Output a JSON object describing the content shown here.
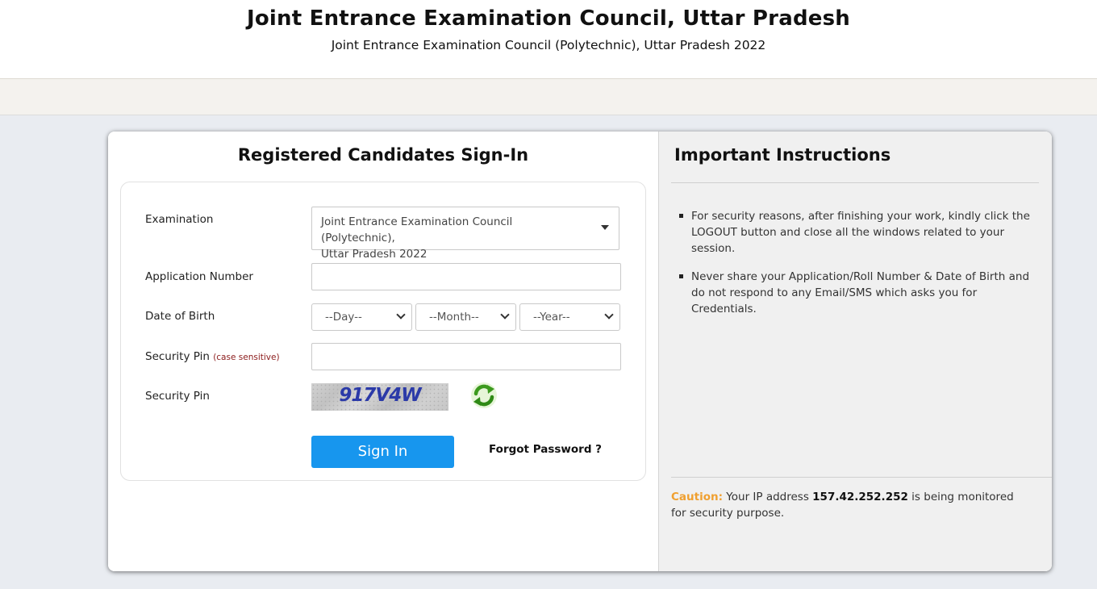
{
  "header": {
    "title": "Joint Entrance Examination Council, Uttar Pradesh",
    "subtitle": "Joint Entrance Examination Council (Polytechnic), Uttar Pradesh 2022"
  },
  "signin": {
    "title": "Registered Candidates Sign-In",
    "examination_label": "Examination",
    "examination_value_line1": "Joint Entrance Examination Council (Polytechnic),",
    "examination_value_line2": "Uttar Pradesh 2022",
    "application_label": "Application Number",
    "application_value": "",
    "dob_label": "Date of Birth",
    "dob_day": "--Day--",
    "dob_month": "--Month--",
    "dob_year": "--Year--",
    "security_pin_label": "Security Pin",
    "security_pin_hint": "(case sensitive)",
    "security_pin_value": "",
    "captcha_label": "Security Pin",
    "captcha_code": "917V4W",
    "refresh_icon": "refresh-icon",
    "signin_button": "Sign In",
    "forgot_password": "Forgot Password ?"
  },
  "instructions": {
    "title": "Important Instructions",
    "items": [
      "For security reasons, after finishing your work, kindly click the LOGOUT button and close all the windows related to your session.",
      "Never share your Application/Roll Number & Date of Birth and do not respond to any Email/SMS which asks you for Credentials."
    ],
    "caution_label": "Caution:",
    "caution_pre": "Your IP address",
    "caution_ip": "157.42.252.252",
    "caution_post": "is being monitored for security purpose."
  },
  "colors": {
    "primary_button": "#1796ee",
    "caution": "#f0a030",
    "page_background": "#e9ecf1",
    "hint": "#8b1a1a"
  }
}
